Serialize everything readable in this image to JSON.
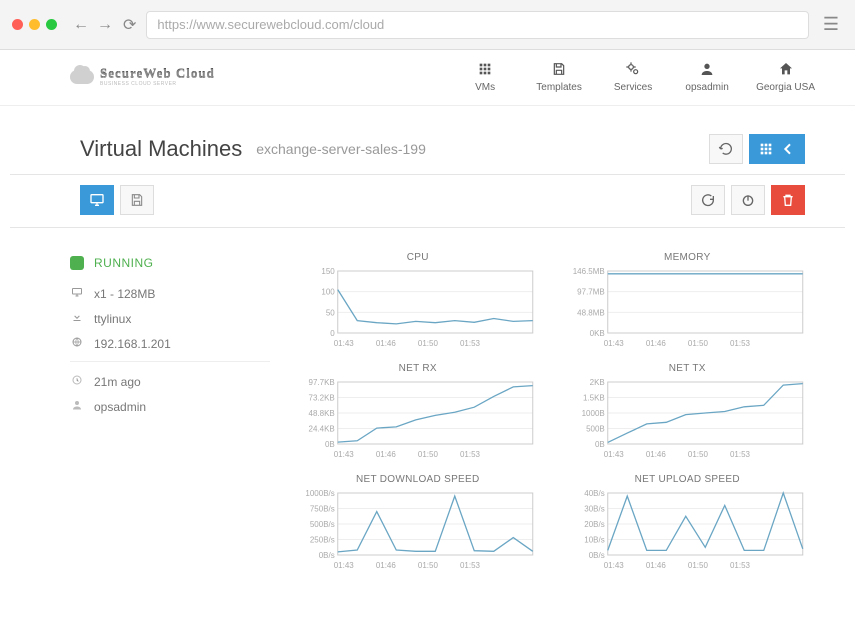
{
  "browser": {
    "url": "https://www.securewebcloud.com/cloud"
  },
  "header": {
    "brand": "SecureWeb Cloud",
    "brand_sub": "BUSINESS CLOUD SERVER",
    "nav": [
      {
        "label": "VMs",
        "icon": "grid"
      },
      {
        "label": "Templates",
        "icon": "floppy"
      },
      {
        "label": "Services",
        "icon": "gears"
      },
      {
        "label": "opsadmin",
        "icon": "user"
      },
      {
        "label": "Georgia USA",
        "icon": "home"
      }
    ]
  },
  "page": {
    "title": "Virtual Machines",
    "subtitle": "exchange-server-sales-199"
  },
  "vm": {
    "status": "RUNNING",
    "spec": "x1 - 128MB",
    "os": "ttylinux",
    "ip": "192.168.1.201",
    "age": "21m ago",
    "owner": "opsadmin"
  },
  "chart_labels": {
    "cpu": "CPU",
    "memory": "MEMORY",
    "net_rx": "NET RX",
    "net_tx": "NET TX",
    "net_dl": "NET DOWNLOAD SPEED",
    "net_ul": "NET UPLOAD SPEED"
  },
  "chart_data": [
    {
      "id": "cpu",
      "type": "line",
      "title": "CPU",
      "y_ticks": [
        "150",
        "100",
        "50",
        "0"
      ],
      "y_ticks_num": [
        150,
        100,
        50,
        0
      ],
      "x_ticks": [
        "01:43",
        "01:46",
        "01:50",
        "01:53"
      ],
      "ylim": [
        0,
        150
      ],
      "xrange": [
        0,
        10
      ],
      "series": [
        {
          "name": "cpu_pct",
          "values": [
            105,
            30,
            25,
            22,
            28,
            25,
            30,
            26,
            35,
            28,
            30
          ]
        }
      ]
    },
    {
      "id": "memory",
      "type": "line",
      "title": "MEMORY",
      "y_ticks": [
        "146.5MB",
        "97.7MB",
        "48.8MB",
        "0KB"
      ],
      "y_ticks_num": [
        146.5,
        97.7,
        48.8,
        0
      ],
      "x_ticks": [
        "01:43",
        "01:46",
        "01:50",
        "01:53"
      ],
      "ylim": [
        0,
        146.5
      ],
      "xrange": [
        0,
        10
      ],
      "series": [
        {
          "name": "mem",
          "values": [
            140,
            140,
            140,
            140,
            140,
            140,
            140,
            140,
            140,
            140,
            140
          ]
        }
      ]
    },
    {
      "id": "net_rx",
      "type": "line",
      "title": "NET RX",
      "y_ticks": [
        "97.7KB",
        "73.2KB",
        "48.8KB",
        "24.4KB",
        "0B"
      ],
      "y_ticks_num": [
        97.7,
        73.2,
        48.8,
        24.4,
        0
      ],
      "x_ticks": [
        "01:43",
        "01:46",
        "01:50",
        "01:53"
      ],
      "ylim": [
        0,
        97.7
      ],
      "xrange": [
        0,
        10
      ],
      "series": [
        {
          "name": "rx",
          "values": [
            3,
            5,
            25,
            27,
            38,
            45,
            50,
            58,
            75,
            90,
            92
          ]
        }
      ]
    },
    {
      "id": "net_tx",
      "type": "line",
      "title": "NET TX",
      "y_ticks": [
        "2KB",
        "1.5KB",
        "1000B",
        "500B",
        "0B"
      ],
      "y_ticks_num": [
        2000,
        1500,
        1000,
        500,
        0
      ],
      "x_ticks": [
        "01:43",
        "01:46",
        "01:50",
        "01:53"
      ],
      "ylim": [
        0,
        2000
      ],
      "xrange": [
        0,
        10
      ],
      "series": [
        {
          "name": "tx",
          "values": [
            50,
            350,
            650,
            700,
            950,
            1000,
            1050,
            1200,
            1250,
            1900,
            1950
          ]
        }
      ]
    },
    {
      "id": "net_dl",
      "type": "line",
      "title": "NET DOWNLOAD SPEED",
      "y_ticks": [
        "1000B/s",
        "750B/s",
        "500B/s",
        "250B/s",
        "0B/s"
      ],
      "y_ticks_num": [
        1000,
        750,
        500,
        250,
        0
      ],
      "x_ticks": [
        "01:43",
        "01:46",
        "01:50",
        "01:53"
      ],
      "ylim": [
        0,
        1000
      ],
      "xrange": [
        0,
        10
      ],
      "series": [
        {
          "name": "dl",
          "values": [
            50,
            80,
            700,
            80,
            60,
            60,
            950,
            70,
            60,
            280,
            60
          ]
        }
      ]
    },
    {
      "id": "net_ul",
      "type": "line",
      "title": "NET UPLOAD SPEED",
      "y_ticks": [
        "40B/s",
        "30B/s",
        "20B/s",
        "10B/s",
        "0B/s"
      ],
      "y_ticks_num": [
        40,
        30,
        20,
        10,
        0
      ],
      "x_ticks": [
        "01:43",
        "01:46",
        "01:50",
        "01:53"
      ],
      "ylim": [
        0,
        40
      ],
      "xrange": [
        0,
        10
      ],
      "series": [
        {
          "name": "ul",
          "values": [
            3,
            38,
            3,
            3,
            25,
            5,
            32,
            3,
            3,
            40,
            4
          ]
        }
      ]
    }
  ]
}
